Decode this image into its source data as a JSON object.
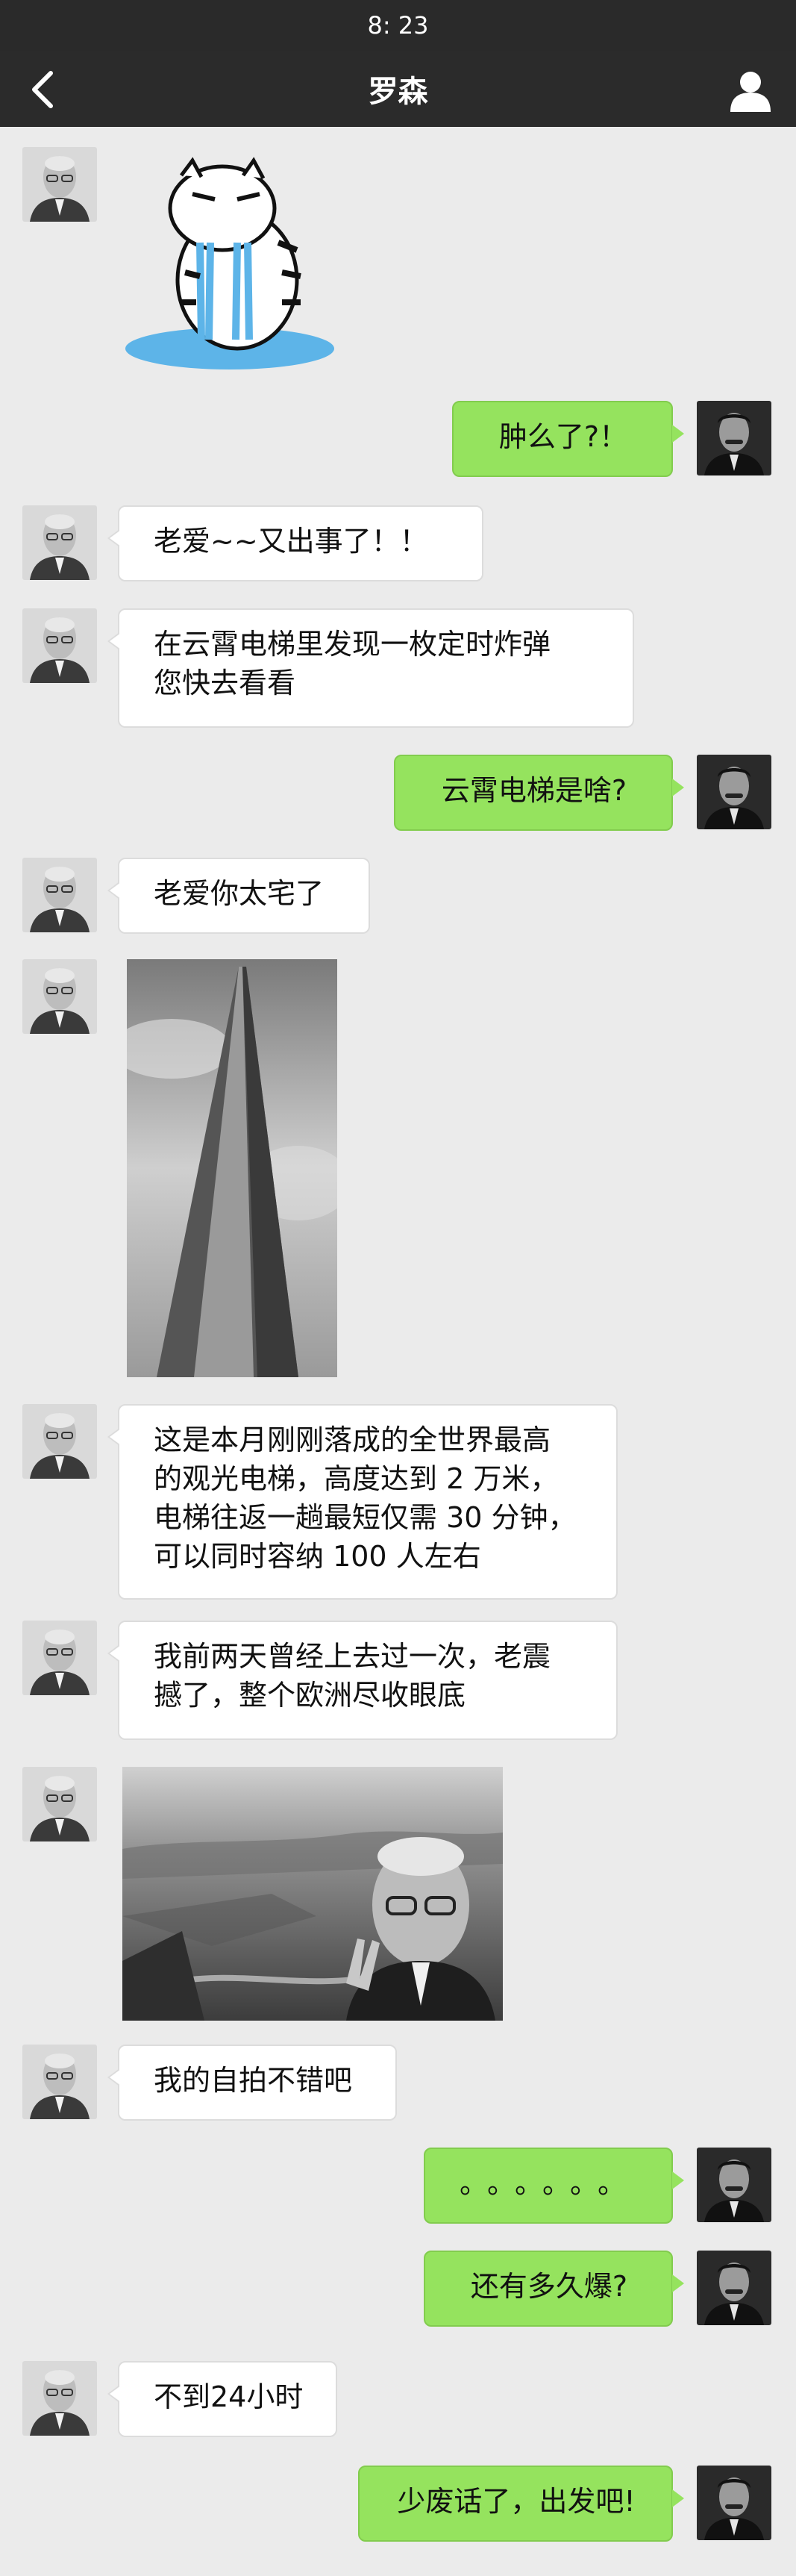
{
  "status_bar": {
    "time": "8: 23"
  },
  "header": {
    "title": "罗森",
    "back_icon": "chevron-left-icon",
    "profile_icon": "person-icon"
  },
  "colors": {
    "nav": "#2b2b2b",
    "background": "#ebebeb",
    "sent_bubble": "#95e35e",
    "received_bubble": "#ffffff"
  },
  "messages": [
    {
      "sender": "罗森",
      "type": "sticker",
      "description": "crying-tiger-sticker"
    },
    {
      "sender": "me",
      "type": "text",
      "lines": [
        "肿么了?！"
      ]
    },
    {
      "sender": "罗森",
      "type": "text",
      "lines": [
        "老爱~~又出事了！！"
      ]
    },
    {
      "sender": "罗森",
      "type": "text",
      "lines": [
        "在云霄电梯里发现一枚定时炸弹",
        "您快去看看"
      ]
    },
    {
      "sender": "me",
      "type": "text",
      "lines": [
        "云霄电梯是啥?"
      ]
    },
    {
      "sender": "罗森",
      "type": "text",
      "lines": [
        "老爱你太宅了"
      ]
    },
    {
      "sender": "罗森",
      "type": "image",
      "description": "tower-photo"
    },
    {
      "sender": "罗森",
      "type": "text",
      "lines": [
        "这是本月刚刚落成的全世界最高",
        "的观光电梯，高度达到 2 万米，",
        "电梯往返一趟最短仅需 30 分钟，",
        "可以同时容纳 100 人左右"
      ]
    },
    {
      "sender": "罗森",
      "type": "text",
      "lines": [
        "我前两天曾经上去过一次，老震",
        "撼了，整个欧洲尽收眼底"
      ]
    },
    {
      "sender": "罗森",
      "type": "image",
      "description": "selfie-photo"
    },
    {
      "sender": "罗森",
      "type": "text",
      "lines": [
        "我的自拍不错吧"
      ]
    },
    {
      "sender": "me",
      "type": "text",
      "lines": [
        "。。。。。。"
      ]
    },
    {
      "sender": "me",
      "type": "text",
      "lines": [
        "还有多久爆?"
      ]
    },
    {
      "sender": "罗森",
      "type": "text",
      "lines": [
        "不到24小时"
      ]
    },
    {
      "sender": "me",
      "type": "text",
      "lines": [
        "少废话了，出发吧!"
      ]
    }
  ]
}
